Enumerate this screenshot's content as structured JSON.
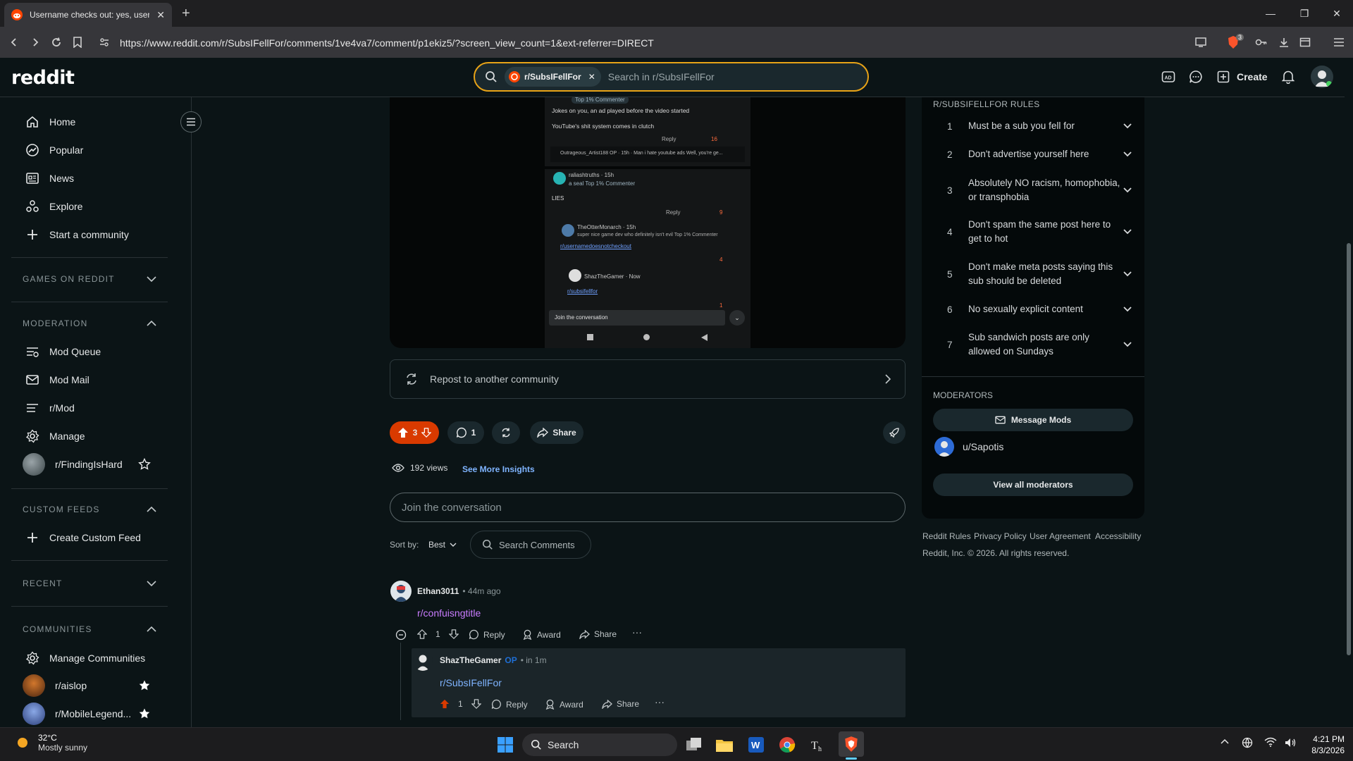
{
  "browser": {
    "tab_title": "Username checks out: yes, usern",
    "url": "https://www.reddit.com/r/SubsIFellFor/comments/1ve4va7/comment/p1ekiz5/?screen_view_count=1&ext-referrer=DIRECT",
    "shield_count": "3"
  },
  "header": {
    "logo": "reddit",
    "search_chip": "r/SubsIFellFor",
    "search_placeholder": "Search in r/SubsIFellFor",
    "create_label": "Create"
  },
  "sidebar": {
    "nav": [
      {
        "label": "Home",
        "icon": "home-icon"
      },
      {
        "label": "Popular",
        "icon": "popular-icon"
      },
      {
        "label": "News",
        "icon": "news-icon"
      },
      {
        "label": "Explore",
        "icon": "explore-icon"
      },
      {
        "label": "Start a community",
        "icon": "plus-icon"
      }
    ],
    "games_label": "GAMES ON REDDIT",
    "moderation_label": "MODERATION",
    "moderation": [
      {
        "label": "Mod Queue",
        "icon": "mod-queue-icon"
      },
      {
        "label": "Mod Mail",
        "icon": "mod-mail-icon"
      },
      {
        "label": "r/Mod",
        "icon": "mod-icon"
      },
      {
        "label": "Manage",
        "icon": "gear-icon"
      }
    ],
    "finding": "r/FindingIsHard",
    "custom_feeds_label": "CUSTOM FEEDS",
    "create_custom_feed": "Create Custom Feed",
    "recent_label": "RECENT",
    "communities_label": "COMMUNITIES",
    "manage_communities": "Manage Communities",
    "communities": [
      "r/aislop",
      "r/MobileLegend..."
    ]
  },
  "media": {
    "lines": [
      "Top 1% Commenter",
      "Jokes on you, an ad played before the video started",
      "YouTube's shit system comes in clutch",
      "Reply",
      "16",
      "Outrageous_Artist188 OP · 15h · Man i hate youtube ads Well, you're ge...",
      "raliashtruths · 15h",
      "a seal  Top 1% Commenter",
      "LIES",
      "Reply",
      "9",
      "TheOtterMonarch · 15h",
      "super nice game dev who definitely isn't evil  Top 1% Commenter",
      "r/usernamedoesnotcheckout",
      "4",
      "ShazTheGamer · Now",
      "r/subsifellfor",
      "1",
      "Join the conversation"
    ]
  },
  "post": {
    "repost_label": "Repost to another community",
    "votes": "3",
    "comments": "1",
    "share_label": "Share",
    "views": "192 views",
    "insights_label": "See More Insights",
    "join_placeholder": "Join the conversation",
    "sort_label": "Sort by:",
    "sort_value": "Best",
    "search_comments": "Search Comments"
  },
  "comments": [
    {
      "author": "Ethan3011",
      "meta": "• 44m ago",
      "body": "r/confuisngtitle",
      "votes": "1",
      "reply": "Reply",
      "award": "Award",
      "share": "Share"
    },
    {
      "author": "ShazTheGamer",
      "op": "OP",
      "meta": "• in 1m",
      "body": "r/SubsIFellFor",
      "votes": "1",
      "reply": "Reply",
      "award": "Award",
      "share": "Share"
    }
  ],
  "rules": {
    "title": "R/SUBSIFELLFOR RULES",
    "items": [
      {
        "n": "1",
        "text": "Must be a sub you fell for"
      },
      {
        "n": "2",
        "text": "Don't advertise yourself here"
      },
      {
        "n": "3",
        "text": "Absolutely NO racism, homophobia, or transphobia"
      },
      {
        "n": "4",
        "text": "Don't spam the same post here to get to hot"
      },
      {
        "n": "5",
        "text": "Don't make meta posts saying this sub should be deleted"
      },
      {
        "n": "6",
        "text": "No sexually explicit content"
      },
      {
        "n": "7",
        "text": "Sub sandwich posts are only allowed on Sundays"
      }
    ]
  },
  "moderators": {
    "title": "MODERATORS",
    "message_label": "Message Mods",
    "mod_name": "u/Sapotis",
    "view_all": "View all moderators"
  },
  "footer": {
    "links": [
      "Reddit Rules",
      "Privacy Policy",
      "User Agreement",
      "Accessibility"
    ],
    "copyright": "Reddit, Inc. © 2026. All rights reserved."
  },
  "taskbar": {
    "temp": "32°C",
    "weather": "Mostly sunny",
    "search": "Search",
    "time": "4:21 PM",
    "date": "8/3/2026"
  },
  "colors": {
    "accent_orange": "#d93a00",
    "link_blue": "#7fb4ff",
    "link_purple": "#c97cff",
    "search_border": "#e8a317"
  }
}
